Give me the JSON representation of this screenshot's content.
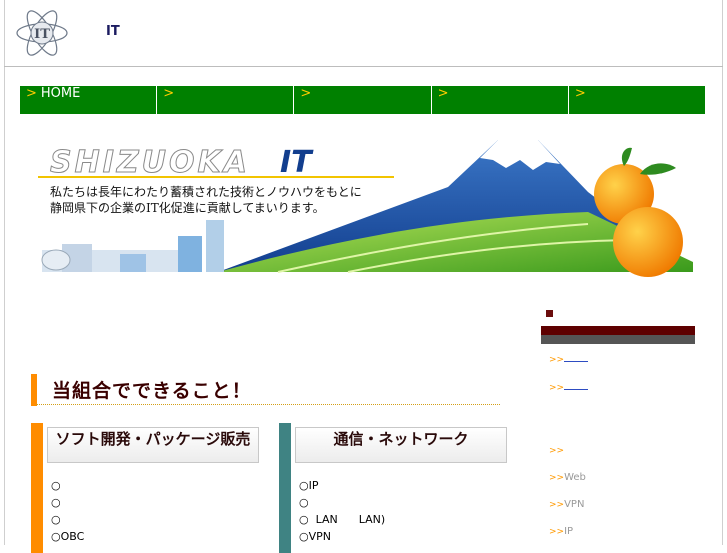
{
  "header": {
    "site_name": "IT",
    "logo_text": "IT"
  },
  "nav": {
    "items": [
      {
        "arrow": ">",
        "label": "HOME"
      },
      {
        "arrow": ">",
        "label": ""
      },
      {
        "arrow": ">",
        "label": ""
      },
      {
        "arrow": ">",
        "label": ""
      },
      {
        "arrow": ">",
        "label": ""
      }
    ]
  },
  "banner": {
    "title_latin": "SHIZUOKA",
    "title_it": "IT",
    "line1": "私たちは長年にわたり蓄積された技術とノウハウをもとに",
    "line2": "静岡県下の企業のIT化促進に貢献してまいります。"
  },
  "sidebar": {
    "links": [
      {
        "arrow": ">>",
        "label": ""
      },
      {
        "arrow": ">>",
        "label": ""
      },
      {
        "arrow": ">>",
        "label": ""
      },
      {
        "arrow": ">>",
        "label": "Web"
      },
      {
        "arrow": ">>",
        "label": "VPN"
      },
      {
        "arrow": ">>",
        "label": "IP"
      }
    ]
  },
  "main": {
    "section_title": "当組合でできること！",
    "panels": [
      {
        "title": "ソフト開発・パッケージ販売",
        "color": "#ff8c00",
        "items": [
          "○",
          "○",
          "○",
          "○OBC"
        ]
      },
      {
        "title": "通信・ネットワーク",
        "color": "#3f8383",
        "items": [
          "○IP",
          "○",
          "○  LAN      LAN)",
          "○VPN"
        ]
      }
    ]
  },
  "colors": {
    "nav_green": "#008000",
    "accent_orange": "#ff8c00",
    "sidebar_maroon": "#5e0000",
    "teal": "#3f8383"
  }
}
